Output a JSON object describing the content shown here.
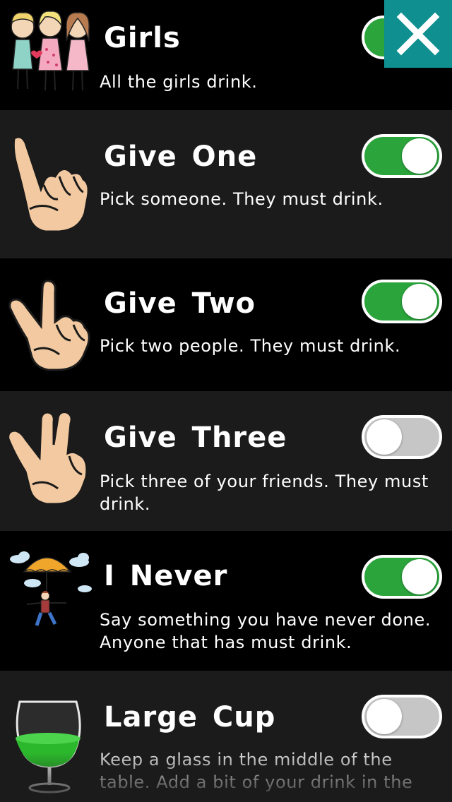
{
  "rules": [
    {
      "title": "Girls",
      "description": "All the girls drink.",
      "enabled": true,
      "icon": "three-girls-icon"
    },
    {
      "title": "Give One",
      "description": "Pick someone. They must drink.",
      "enabled": true,
      "icon": "one-finger-hand-icon"
    },
    {
      "title": "Give Two",
      "description": "Pick two people. They must drink.",
      "enabled": true,
      "icon": "two-finger-hand-icon"
    },
    {
      "title": "Give Three",
      "description": "Pick three of your friends. They must drink.",
      "enabled": false,
      "icon": "three-finger-hand-icon"
    },
    {
      "title": "I Never",
      "description": "Say something you have never done. Anyone that has must drink.",
      "enabled": true,
      "icon": "parachute-person-icon"
    },
    {
      "title": "Large Cup",
      "description": "Keep a glass in the middle of the table. Add a bit of your drink in the",
      "enabled": false,
      "icon": "wine-glass-icon"
    }
  ],
  "close_icon": "close-icon",
  "colors": {
    "toggle_on": "#2ba43c",
    "toggle_off": "#c6c6c6",
    "close_bg": "#0f8f8f",
    "row_light": "#1b1b1b",
    "row_dark": "#000000"
  }
}
